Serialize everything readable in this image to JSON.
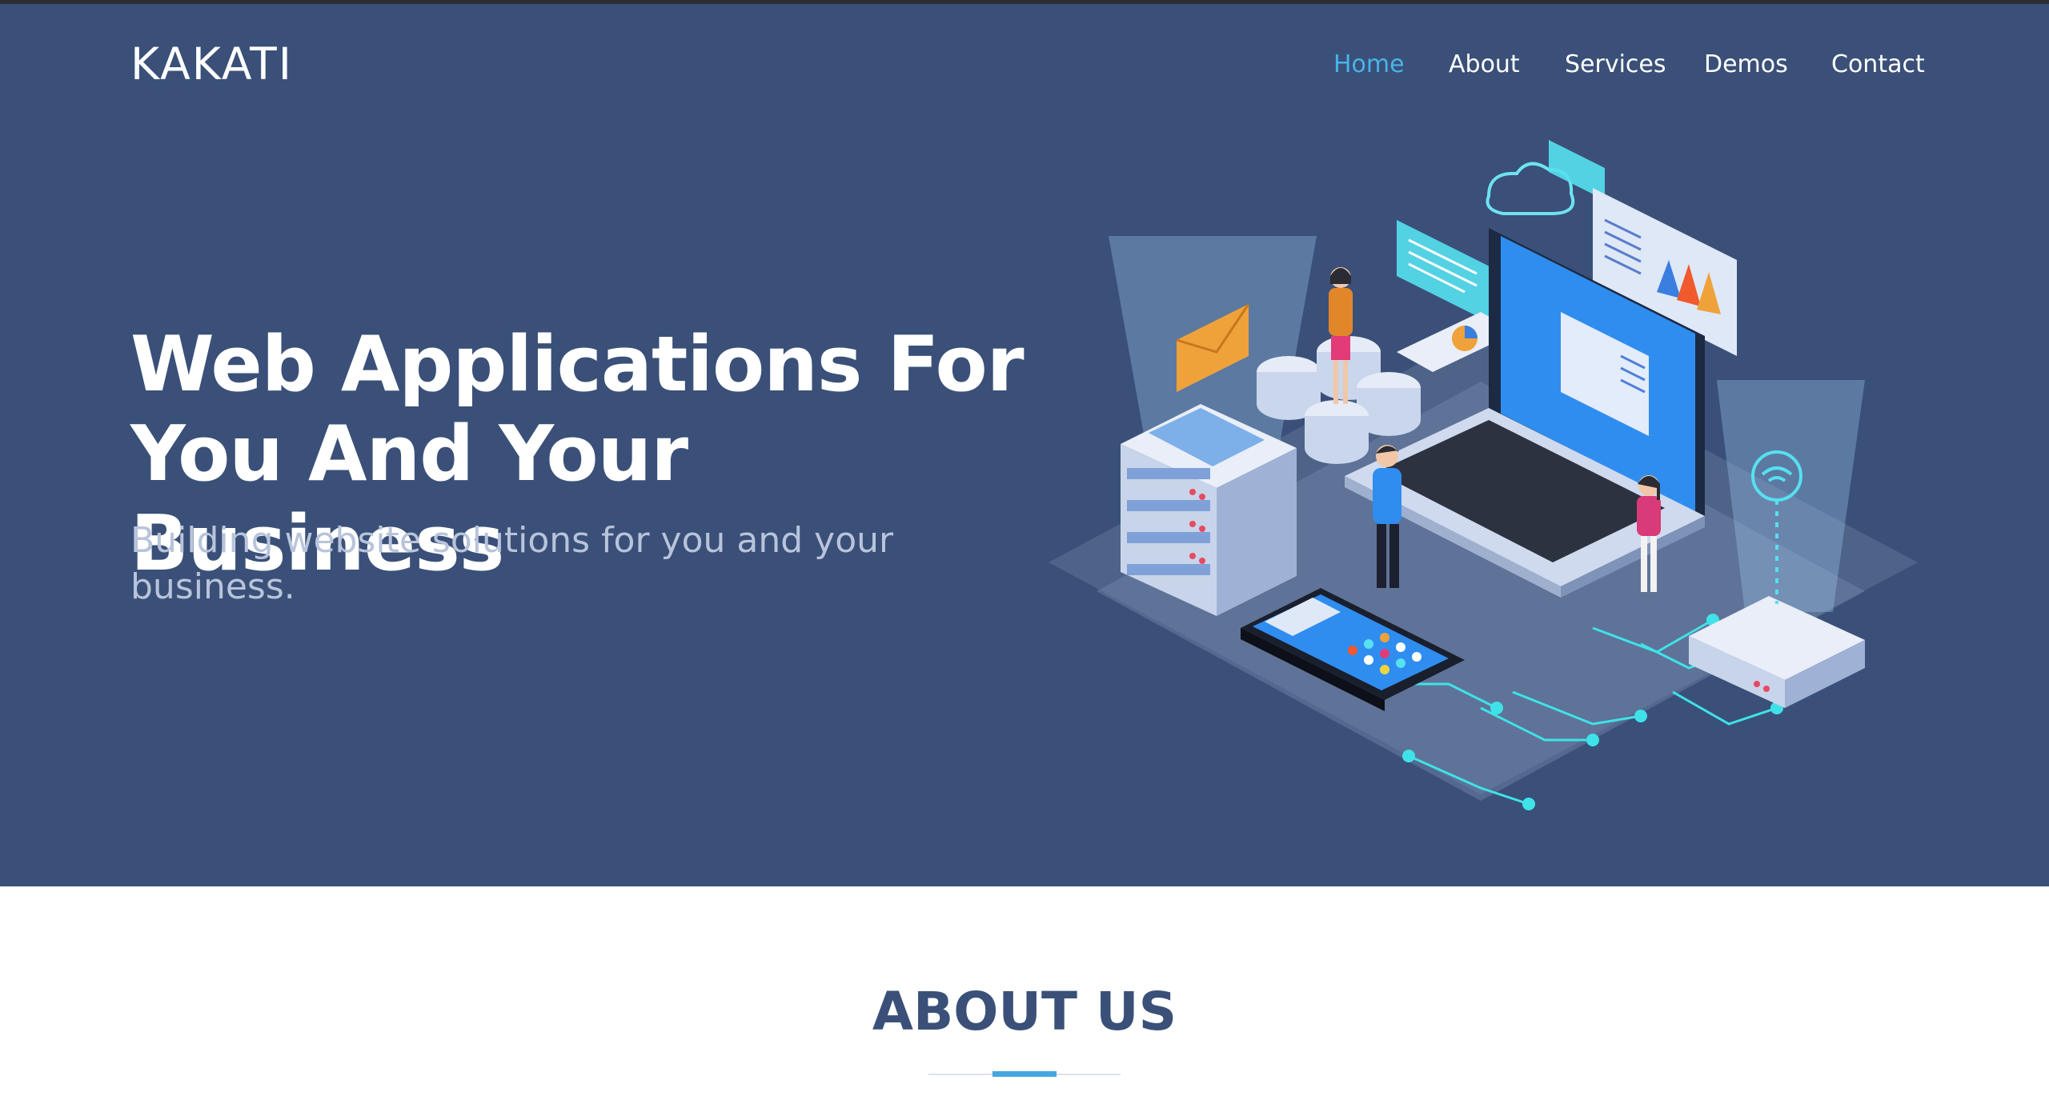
{
  "brand": {
    "name": "KAKATI"
  },
  "nav": {
    "items": [
      {
        "label": "Home",
        "active": true
      },
      {
        "label": "About",
        "active": false
      },
      {
        "label": "Services",
        "active": false
      },
      {
        "label": "Demos",
        "active": false
      },
      {
        "label": "Contact",
        "active": false
      }
    ]
  },
  "hero": {
    "title_line1": "Web Applications For",
    "title_line2": "You And Your Business",
    "subtitle": "Building website solutions for you and your business.",
    "illustration": "isometric-web-development-illustration"
  },
  "about": {
    "heading": "ABOUT US"
  },
  "colors": {
    "hero_bg": "#3a5078",
    "nav_active": "#49b3e8",
    "accent": "#46a6df",
    "heading": "#3a5078"
  }
}
